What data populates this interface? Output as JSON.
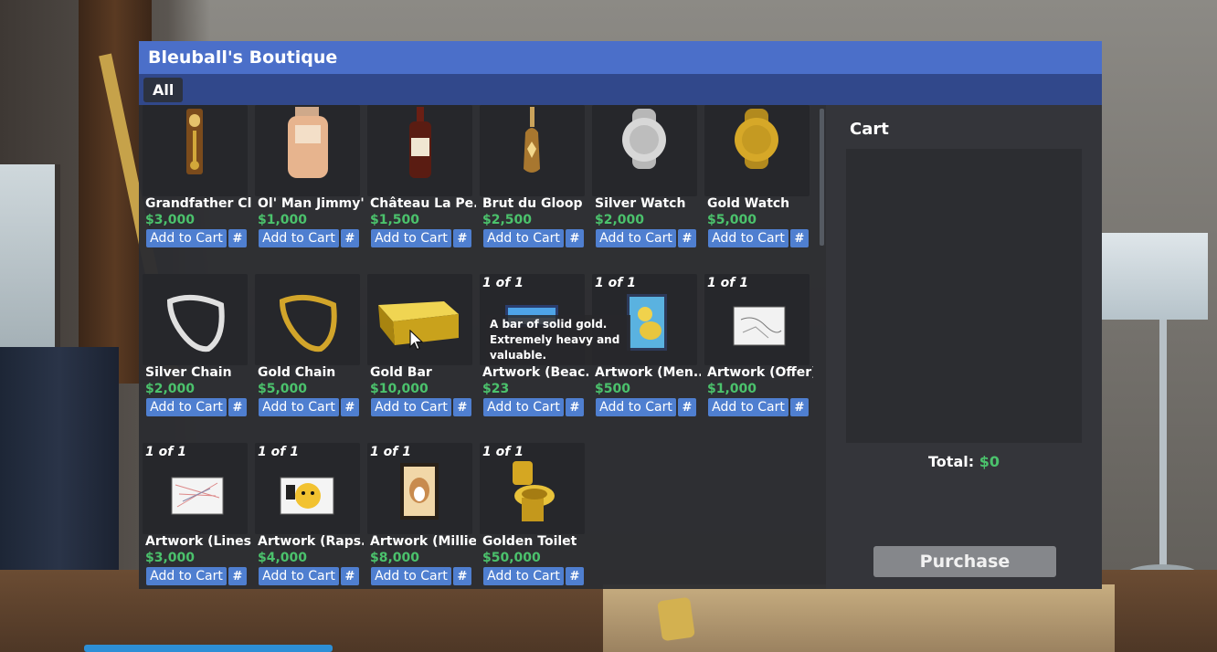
{
  "shop": {
    "title": "Bleuball's Boutique",
    "tabs": [
      {
        "label": "All"
      }
    ],
    "add_label": "Add to Cart",
    "hash_label": "#",
    "items": [
      {
        "name": "Grandfather Cl...",
        "price": "$3,000",
        "qty": ""
      },
      {
        "name": "Ol' Man Jimmy's",
        "price": "$1,000",
        "qty": ""
      },
      {
        "name": "Château La Pe...",
        "price": "$1,500",
        "qty": ""
      },
      {
        "name": "Brut du Gloop",
        "price": "$2,500",
        "qty": ""
      },
      {
        "name": "Silver Watch",
        "price": "$2,000",
        "qty": ""
      },
      {
        "name": "Gold Watch",
        "price": "$5,000",
        "qty": ""
      },
      {
        "name": "Silver Chain",
        "price": "$2,000",
        "qty": ""
      },
      {
        "name": "Gold Chain",
        "price": "$5,000",
        "qty": ""
      },
      {
        "name": "Gold Bar",
        "price": "$10,000",
        "qty": ""
      },
      {
        "name": "Artwork (Beac...",
        "price": "$23",
        "qty": "1 of 1"
      },
      {
        "name": "Artwork (Men...",
        "price": "$500",
        "qty": "1 of 1"
      },
      {
        "name": "Artwork (Offer)",
        "price": "$1,000",
        "qty": "1 of 1"
      },
      {
        "name": "Artwork (Lines)",
        "price": "$3,000",
        "qty": "1 of 1"
      },
      {
        "name": "Artwork (Raps...",
        "price": "$4,000",
        "qty": "1 of 1"
      },
      {
        "name": "Artwork (Millie)",
        "price": "$8,000",
        "qty": "1 of 1"
      },
      {
        "name": "Golden Toilet",
        "price": "$50,000",
        "qty": "1 of 1"
      }
    ],
    "tooltip": "A bar of solid gold. Extremely heavy and valuable."
  },
  "cart": {
    "title": "Cart",
    "total_label": "Total:",
    "total_value": "$0",
    "purchase_label": "Purchase"
  },
  "colors": {
    "title_bar": "#4b6fc9",
    "tab_bar": "#31488b",
    "button": "#4f7fd0",
    "price_green": "#4bc26c",
    "purchase_disabled": "#85878b"
  }
}
